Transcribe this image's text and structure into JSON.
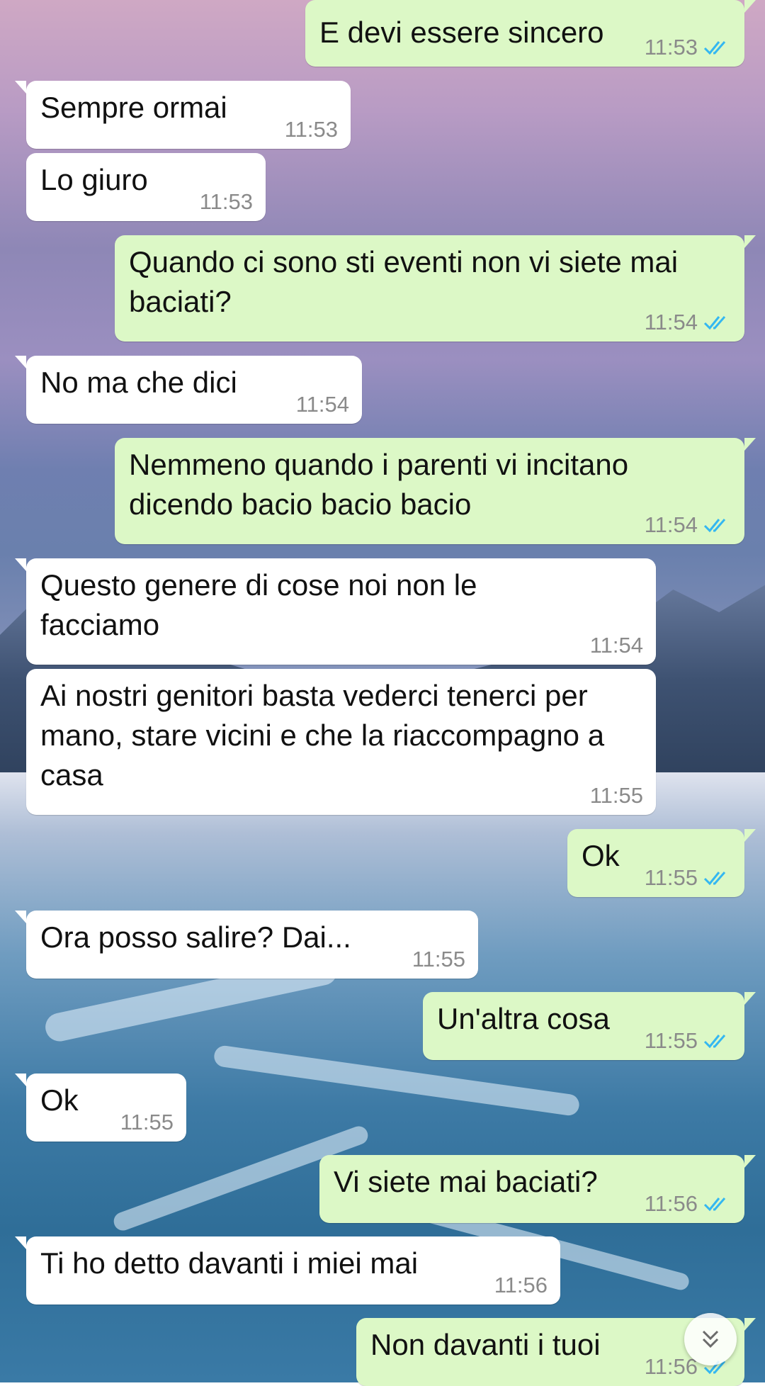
{
  "messages": [
    {
      "dir": "out",
      "text": "E devi essere sincero",
      "time": "11:53",
      "read": true
    },
    {
      "dir": "in",
      "text": "Sempre ormai",
      "time": "11:53"
    },
    {
      "dir": "in",
      "text": "Lo giuro",
      "time": "11:53"
    },
    {
      "dir": "out",
      "text": "Quando ci sono sti eventi non vi siete mai baciati?",
      "time": "11:54",
      "read": true
    },
    {
      "dir": "in",
      "text": "No ma che dici",
      "time": "11:54"
    },
    {
      "dir": "out",
      "text": "Nemmeno quando i parenti vi incitano dicendo bacio bacio bacio",
      "time": "11:54",
      "read": true
    },
    {
      "dir": "in",
      "text": "Questo genere di cose noi non le facciamo",
      "time": "11:54"
    },
    {
      "dir": "in",
      "text": "Ai nostri genitori basta vederci tenerci per mano, stare vicini e che la riaccompagno a casa",
      "time": "11:55"
    },
    {
      "dir": "out",
      "text": "Ok",
      "time": "11:55",
      "read": true
    },
    {
      "dir": "in",
      "text": "Ora posso salire? Dai...",
      "time": "11:55"
    },
    {
      "dir": "out",
      "text": "Un'altra cosa",
      "time": "11:55",
      "read": true
    },
    {
      "dir": "in",
      "text": "Ok",
      "time": "11:55"
    },
    {
      "dir": "out",
      "text": "Vi siete mai baciati?",
      "time": "11:56",
      "read": true
    },
    {
      "dir": "in",
      "text": "Ti ho detto davanti i miei mai",
      "time": "11:56"
    },
    {
      "dir": "out",
      "text": "Non davanti i tuoi",
      "time": "11:56",
      "read": true
    }
  ],
  "colors": {
    "outgoing_bubble": "#dcf8c6",
    "incoming_bubble": "#ffffff",
    "read_ticks": "#34b7f1",
    "timestamp": "#8a8a8a"
  },
  "icons": {
    "read_receipt": "double-check-icon",
    "scroll_down": "double-chevron-down-icon"
  }
}
